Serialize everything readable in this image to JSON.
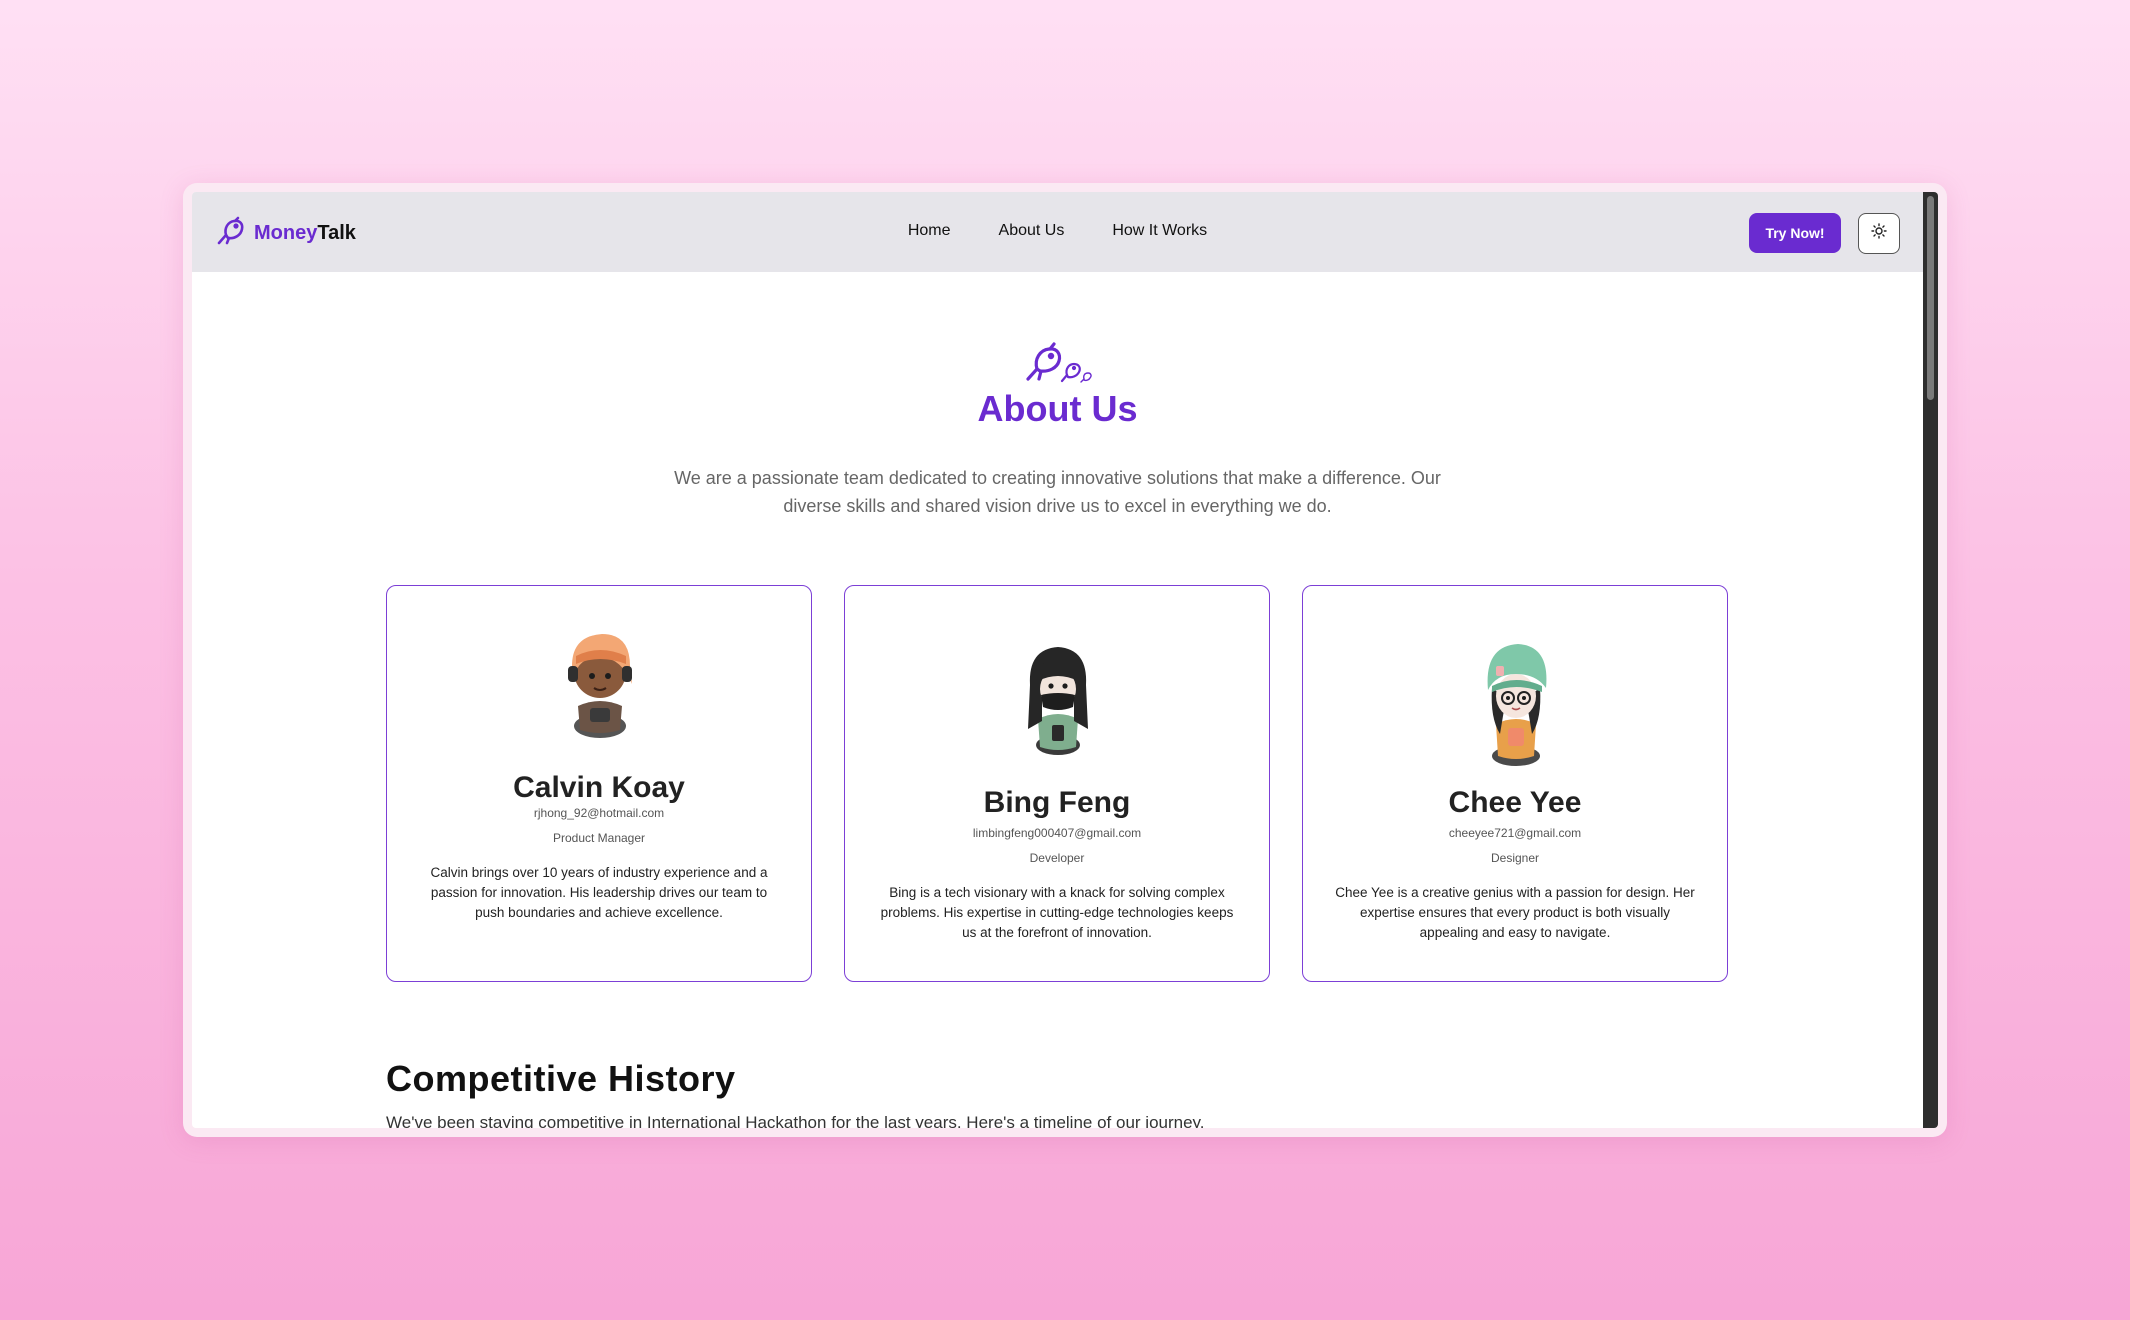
{
  "navbar": {
    "brand_first": "Money",
    "brand_second": "Talk",
    "links": [
      "Home",
      "About Us",
      "How It Works"
    ],
    "cta_label": "Try Now!"
  },
  "hero": {
    "title": "About Us",
    "description": "We are a passionate team dedicated to creating innovative solutions that make a difference. Our diverse skills and shared vision drive us to excel in everything we do."
  },
  "team": [
    {
      "name": "Calvin Koay",
      "email": "rjhong_92@hotmail.com",
      "role": "Product Manager",
      "bio": "Calvin brings over 10 years of industry experience and a passion for innovation. His leadership drives our team to push boundaries and achieve excellence."
    },
    {
      "name": "Bing Feng",
      "email": "limbingfeng000407@gmail.com",
      "role": "Developer",
      "bio": "Bing is a tech visionary with a knack for solving complex problems. His expertise in cutting-edge technologies keeps us at the forefront of innovation."
    },
    {
      "name": "Chee Yee",
      "email": "cheeyee721@gmail.com",
      "role": "Designer",
      "bio": "Chee Yee is a creative genius with a passion for design. Her expertise ensures that every product is both visually appealing and easy to navigate."
    }
  ],
  "history": {
    "title": "Competitive History",
    "description": "We've been staying competitive in International Hackathon for the last years. Here's a timeline of our journey."
  },
  "colors": {
    "accent": "#6a2bd0",
    "navbar_bg": "#e6e5ea",
    "card_border": "#7c3fd6"
  },
  "icons": [
    "bird-logo-icon",
    "sun-icon",
    "comment-icon",
    "eye-icon",
    "menu-lines-icon"
  ]
}
